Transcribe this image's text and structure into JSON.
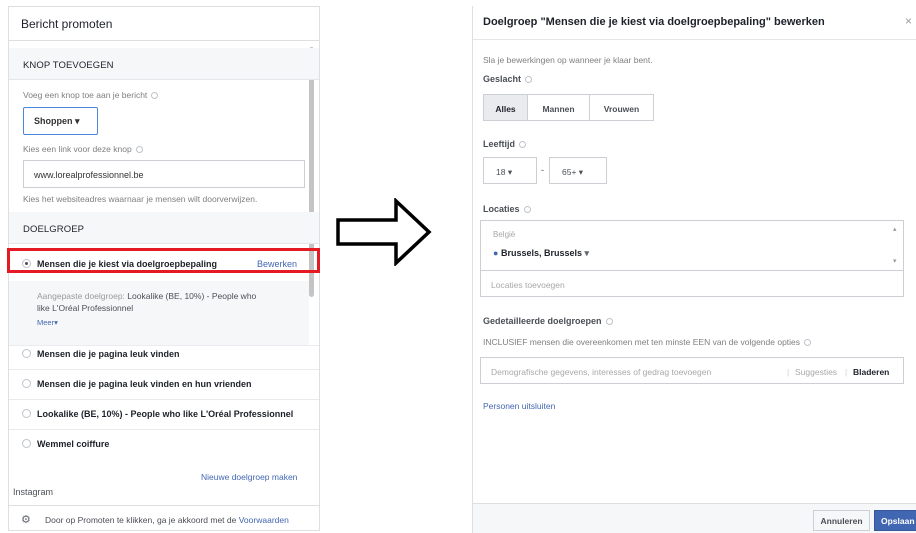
{
  "left": {
    "title": "Bericht promoten",
    "button_section": {
      "heading": "KNOP TOEVOEGEN",
      "add_label": "Voeg een knop toe aan je bericht",
      "button_value": "Shoppen",
      "link_label": "Kies een link voor deze knop",
      "url_value": "www.lorealprofessionnel.be",
      "url_help": "Kies het websiteadres waarnaar je mensen wilt doorverwijzen."
    },
    "audience_section": {
      "heading": "DOELGROEP",
      "selected_option": "Mensen die je kiest via doelgroepbepaling",
      "edit_link": "Bewerken",
      "custom_prefix": "Aangepaste doelgroep:",
      "custom_line1": "Lookalike (BE, 10%) - People who",
      "custom_line2": "like L'Oréal Professionnel",
      "more_link": "Meer",
      "options": [
        "Mensen die je pagina leuk vinden",
        "Mensen die je pagina leuk vinden en hun vrienden",
        "Lookalike (BE, 10%) - People who like L'Oréal Professionnel",
        "Wemmel coiffure"
      ],
      "new_audience_link": "Nieuwe doelgroep maken"
    },
    "instagram_label": "Instagram",
    "footer_text": "Door op Promoten te klikken, ga je akkoord met de",
    "footer_link": "Voorwaarden"
  },
  "right": {
    "title": "Doelgroep \"Mensen die je kiest via doelgroepbepaling\" bewerken",
    "close": "×",
    "save_hint": "Sla je bewerkingen op wanneer je klaar bent.",
    "gender_label": "Geslacht",
    "gender_options": [
      "Alles",
      "Mannen",
      "Vrouwen"
    ],
    "gender_selected": "Alles",
    "age_label": "Leeftijd",
    "age_min": "18",
    "age_sep": "-",
    "age_max": "65+",
    "locations_label": "Locaties",
    "country": "België",
    "location_value": "Brussels, Brussels",
    "add_locations_placeholder": "Locaties toevoegen",
    "detailed_label": "Gedetailleerde doelgroepen",
    "inclusive_text": "INCLUSIEF mensen die overeenkomen met ten minste EEN van de volgende opties",
    "detail_placeholder": "Demografische gegevens, interesses of gedrag toevoegen",
    "suggestions": "Suggesties",
    "browse": "Bladeren",
    "exclude_link": "Personen uitsluiten",
    "cancel_label": "Annuleren",
    "save_label": "Opslaan"
  },
  "colors": {
    "link_blue": "#4267b2",
    "highlight_red": "#e41b23",
    "border_gray": "#ccd0d5",
    "panel_bg": "#f6f7f9"
  }
}
